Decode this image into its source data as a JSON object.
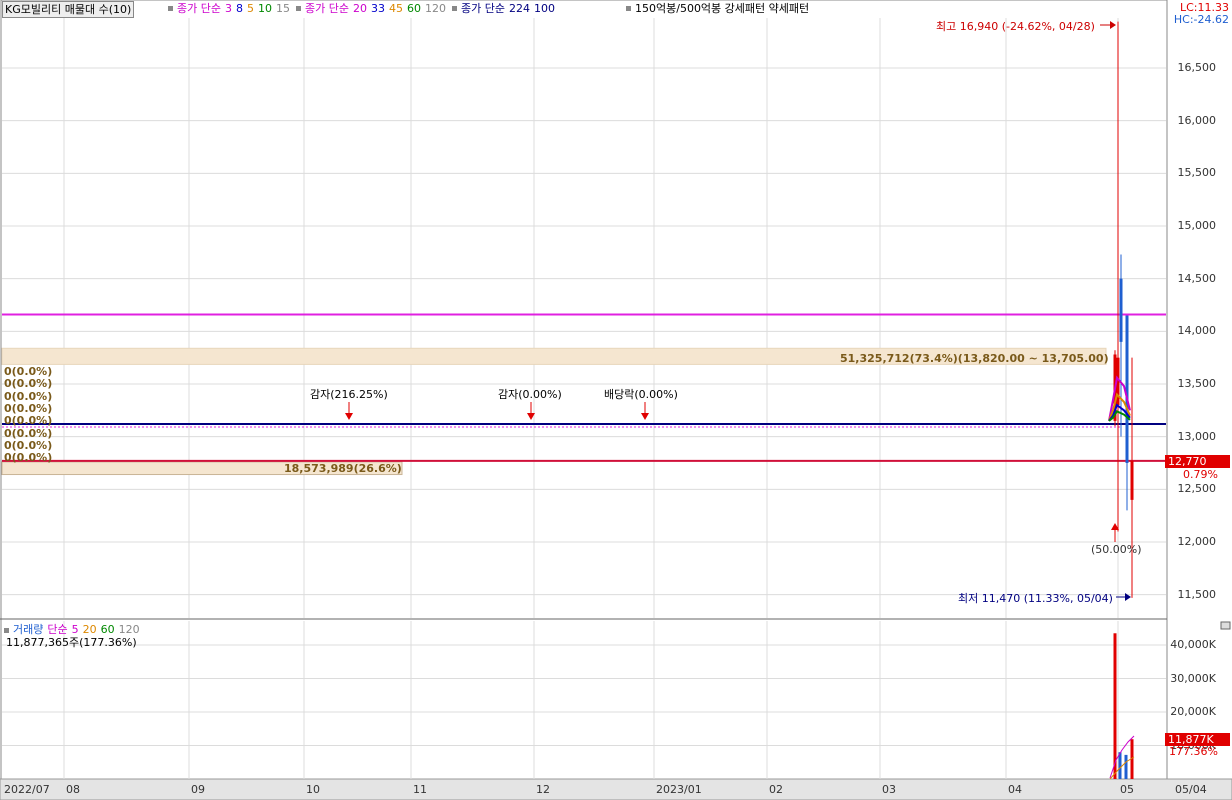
{
  "header": {
    "title": "KG모빌리티 매물대 수(10)",
    "ma_groups": [
      {
        "label": "종가 단순",
        "color": "#cc00cc",
        "periods": [
          {
            "p": "3",
            "color": "#cc00cc"
          },
          {
            "p": "8",
            "color": "#0000cc"
          },
          {
            "p": "5",
            "color": "#dd8800"
          },
          {
            "p": "10",
            "color": "#008800"
          },
          {
            "p": "15",
            "color": "#888888"
          }
        ]
      },
      {
        "label": "종가 단순",
        "color": "#cc00cc",
        "periods": [
          {
            "p": "20",
            "color": "#cc00cc"
          },
          {
            "p": "33",
            "color": "#0000cc"
          },
          {
            "p": "45",
            "color": "#dd8800"
          },
          {
            "p": "60",
            "color": "#008800"
          },
          {
            "p": "120",
            "color": "#888888"
          }
        ]
      },
      {
        "label": "종가 단순",
        "color": "#000080",
        "periods": [
          {
            "p": "224",
            "color": "#000080"
          },
          {
            "p": "100",
            "color": "#000080"
          }
        ]
      }
    ],
    "pattern_label": "150억봉/500억봉 강세패턴  약세패턴",
    "lc": "LC:11.33",
    "hc": "HC:-24.62"
  },
  "chart_data": {
    "type": "candlestick",
    "x_ticks": [
      "2022/07",
      "08",
      "09",
      "10",
      "11",
      "12",
      "2023/01",
      "02",
      "03",
      "04",
      "05",
      "05/04"
    ],
    "y_ticks": [
      "16,500",
      "16,000",
      "15,500",
      "15,000",
      "14,500",
      "14,000",
      "13,500",
      "13,000",
      "12,500",
      "12,000",
      "11,500"
    ],
    "ylim": [
      11300,
      17200
    ],
    "current_price": "12,770",
    "current_change": "0.79%",
    "high_note": "최고 16,940 (-24.62%, 04/28)",
    "low_note": "최저 11,470 (11.33%, 05/04)",
    "candles": [
      {
        "o": 13150,
        "h": 13820,
        "l": 13100,
        "c": 13780,
        "color": "#e00000"
      },
      {
        "o": 13750,
        "h": 16940,
        "l": 12100,
        "c": 13300,
        "color": "#e00000"
      },
      {
        "o": 13900,
        "h": 14730,
        "l": 13000,
        "c": 14500,
        "color": "#1f5fd0"
      },
      {
        "o": 14150,
        "h": 14150,
        "l": 12300,
        "c": 12750,
        "color": "#1f5fd0"
      },
      {
        "o": 12400,
        "h": 13750,
        "l": 11470,
        "c": 12770,
        "color": "#e00000"
      }
    ],
    "ma_lines": [
      {
        "color": "#cc00cc",
        "values": [
          13150,
          13350,
          13560,
          13480,
          13250
        ]
      },
      {
        "color": "#dd8800",
        "values": [
          13150,
          13250,
          13400,
          13330,
          13200
        ]
      },
      {
        "color": "#0000cc",
        "values": [
          13150,
          13200,
          13300,
          13250,
          13180
        ]
      },
      {
        "color": "#008800",
        "values": [
          13150,
          13180,
          13240,
          13210,
          13160
        ]
      }
    ],
    "h_lines": [
      {
        "price": 14160,
        "color": "#e020e0"
      },
      {
        "price": 13120,
        "color": "#000080"
      },
      {
        "price": 12770,
        "color": "#d0103a"
      }
    ],
    "volume_profile": [
      {
        "label": "51,325,712(73.4%)(13,820.00 ~ 13,705.00)",
        "from": 13705,
        "to": 13820,
        "pct": 73.4
      },
      {
        "label": "18,573,989(26.6%)",
        "from": 12650,
        "to": 12770,
        "pct": 26.6
      }
    ],
    "profile_zero_labels": [
      "0(0.0%)",
      "0(0.0%)",
      "0(0.0%)",
      "0(0.0%)",
      "0(0.0%)",
      "0(0.0%)",
      "0(0.0%)",
      "0(0.0%)"
    ],
    "events": [
      {
        "label": "감자(216.25%)",
        "month": 3.35
      },
      {
        "label": "감자(0.00%)",
        "month": 5.0
      },
      {
        "label": "배당락(0.00%)",
        "month": 5.9
      }
    ],
    "up_marker_label": "(50.00%)",
    "volume": {
      "legend_title": "거래량",
      "legend_ma_label": "단순",
      "legend_periods": [
        {
          "p": "5",
          "color": "#cc00cc"
        },
        {
          "p": "20",
          "color": "#dd8800"
        },
        {
          "p": "60",
          "color": "#008800"
        },
        {
          "p": "120",
          "color": "#888888"
        }
      ],
      "current_text": "11,877,365주(177.36%)",
      "y_ticks": [
        "40,000K",
        "30,000K",
        "20,000K",
        "10,000K"
      ],
      "ylim": [
        0,
        48000
      ],
      "current_tag": "11,877K",
      "current_pct": "177.36%",
      "bars": [
        {
          "v": 43500,
          "color": "#e00000"
        },
        {
          "v": 8000,
          "color": "#1f5fd0"
        },
        {
          "v": 7200,
          "color": "#1f5fd0"
        },
        {
          "v": 11877,
          "color": "#e00000"
        }
      ]
    }
  }
}
